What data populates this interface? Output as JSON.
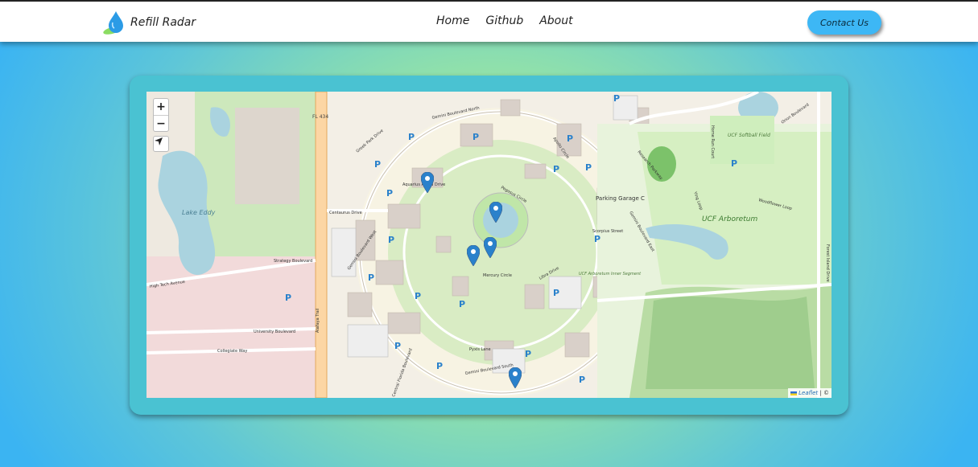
{
  "navbar": {
    "brand_name": "Refill Radar",
    "links": [
      "Home",
      "Github",
      "About"
    ],
    "contact_label": "Contact Us"
  },
  "map": {
    "zoom_in_label": "+",
    "zoom_out_label": "−",
    "attribution_link": "Leaflet",
    "attribution_suffix": " | ©",
    "marker_count": 5,
    "places": {
      "arboretum": "UCF Arboretum",
      "lake": "Lake Eddy",
      "garage": "Parking Garage C",
      "softball": "UCF Softball Field",
      "inner_segment": "UCF Arboretum Inner Segment",
      "fl434": "FL 434"
    },
    "streets": {
      "gemini_north": "Gemini Boulevard North",
      "gemini_south": "Gemini Boulevard South",
      "gemini_east": "Gemini Boulevard East",
      "gemini_west": "Gemini Boulevard West",
      "alafaya": "Alafaya Trail",
      "centaurus": "Centaurus Drive",
      "strategy": "Strategy Boulevard",
      "university": "University Boulevard",
      "collegiate": "Collegiate Way",
      "high_tech": "High Tech Avenue",
      "scorpius": "Scorpius Street",
      "mercury": "Mercury Circle",
      "pegasus": "Pegasus Circle",
      "aquarius": "Aquarius Agora Drive",
      "libra": "Libra Drive",
      "pyxis": "Pyxis Lane",
      "greek_park": "Greek Park Drive",
      "orion": "Orion Boulevard",
      "forest_island": "Forest Island Drive",
      "woodflower": "Woodflower Loop",
      "home_run": "Home Run Court",
      "apollo": "Apollo Circle",
      "central_florida": "Central Florida Boulevard",
      "research": "Research Parkway",
      "ying": "Ying Loop"
    }
  },
  "colors": {
    "nav_bg": "#ffffff",
    "contact_bg": "#3db7f5",
    "card_bg": "#4ac2d2",
    "marker": "#2a81cb",
    "park": "#c8e9b6",
    "water": "#aad3df",
    "urban": "#f2dada"
  }
}
